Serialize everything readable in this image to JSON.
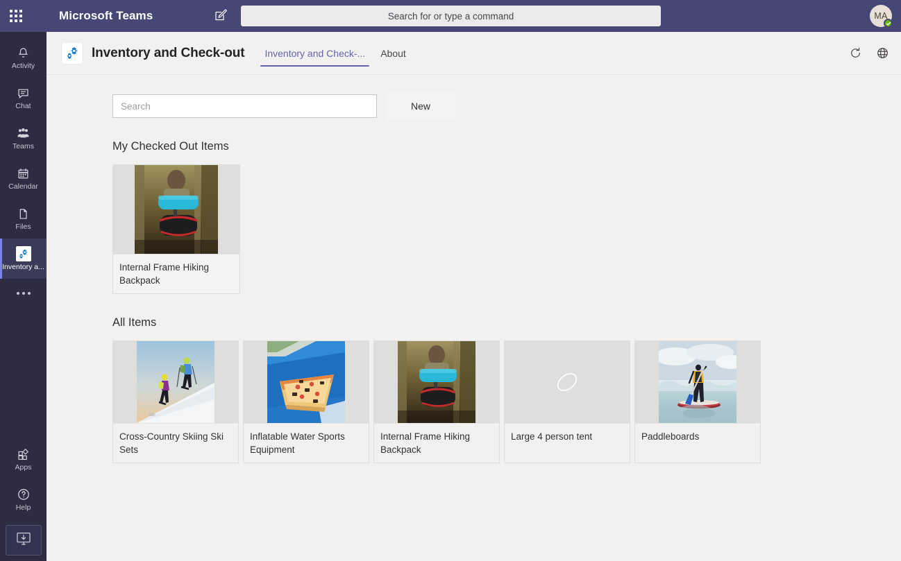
{
  "titlebar": {
    "app_launcher_icon": "waffle-grid-icon",
    "title": "Microsoft Teams",
    "compose_icon": "compose-pencil-icon",
    "search": {
      "placeholder": "Search for or type a command"
    },
    "avatar": {
      "initials": "MA",
      "presence": "Available"
    }
  },
  "rail": {
    "items": [
      {
        "label": "Activity",
        "icon": "bell-icon",
        "active": false
      },
      {
        "label": "Chat",
        "icon": "chat-bubble-icon",
        "active": false
      },
      {
        "label": "Teams",
        "icon": "people-icon",
        "active": false
      },
      {
        "label": "Calendar",
        "icon": "calendar-icon",
        "active": false
      },
      {
        "label": "Files",
        "icon": "file-icon",
        "active": false
      },
      {
        "label": "Inventory a...",
        "icon": "gears-app-icon",
        "active": true
      }
    ],
    "more_label": "More options",
    "bottom": [
      {
        "label": "Apps",
        "icon": "apps-icon"
      },
      {
        "label": "Help",
        "icon": "help-circle-icon"
      }
    ],
    "download_label": "Download desktop app",
    "download_icon": "download-monitor-icon"
  },
  "channel_header": {
    "app_icon": "gears-app-icon",
    "title": "Inventory and Check-out",
    "tabs": [
      {
        "label": "Inventory and Check-...",
        "active": true
      },
      {
        "label": "About",
        "active": false
      }
    ],
    "actions": [
      {
        "name": "refresh-icon",
        "title": "Refresh"
      },
      {
        "name": "globe-icon",
        "title": "Open in browser"
      }
    ]
  },
  "app": {
    "search": {
      "value": "",
      "placeholder": "Search"
    },
    "new_button": "New",
    "sections": [
      {
        "title": "My Checked Out Items",
        "items": [
          {
            "label": "Internal Frame Hiking Backpack",
            "image": "hiking-backpack-photo"
          }
        ]
      },
      {
        "title": "All Items",
        "items": [
          {
            "label": "Cross-Country Skiing Ski Sets",
            "image": "skiing-photo"
          },
          {
            "label": "Inflatable Water Sports Equipment",
            "image": "pool-float-photo"
          },
          {
            "label": "Internal Frame Hiking Backpack",
            "image": "hiking-backpack-photo"
          },
          {
            "label": "Large 4 person tent",
            "image": "no-image-placeholder"
          },
          {
            "label": "Paddleboards",
            "image": "paddleboard-photo"
          }
        ]
      }
    ]
  },
  "colors": {
    "brand_purple": "#464775",
    "rail_dark": "#2d2c42",
    "accent": "#6264a7",
    "canvas_bg": "#f2f1f0",
    "presence_green": "#6bb700",
    "gear_blue": "#0d6cbf"
  }
}
